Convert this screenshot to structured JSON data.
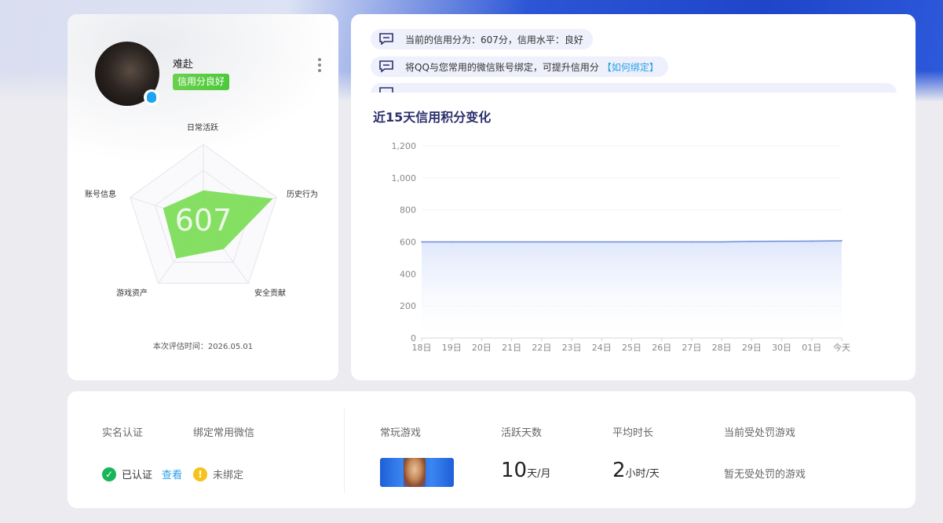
{
  "profile": {
    "name": "难赴",
    "credit_tag": "信用分良好",
    "score": "607",
    "eval_time": "本次评估时间：2026.05.01",
    "radar": {
      "dimensions": [
        "日常活跃",
        "历史行为",
        "安全贡献",
        "游戏资产",
        "账号信息"
      ],
      "values": [
        0.4,
        0.95,
        0.45,
        0.6,
        0.55
      ]
    }
  },
  "notices": [
    {
      "text": "当前的信用分为：607分，信用水平：良好",
      "link": ""
    },
    {
      "text": "将QQ与您常用的微信账号绑定，可提升信用分",
      "link": "【如何绑定】"
    }
  ],
  "chart_data": {
    "type": "area",
    "title": "近15天信用积分变化",
    "categories": [
      "18日",
      "19日",
      "20日",
      "21日",
      "22日",
      "23日",
      "24日",
      "25日",
      "26日",
      "27日",
      "28日",
      "29日",
      "30日",
      "01日",
      "今天"
    ],
    "values": [
      600,
      600,
      600,
      600,
      600,
      600,
      600,
      600,
      600,
      600,
      600,
      603,
      604,
      605,
      607
    ],
    "yticks": [
      "0",
      "200",
      "400",
      "600",
      "800",
      "1,000",
      "1,200"
    ],
    "ylim": [
      0,
      1200
    ],
    "grid": true,
    "colors": {
      "line": "#6b8ed8",
      "fill": "#dfe7fb"
    }
  },
  "bottom": {
    "realname_label": "实名认证",
    "realname_status": "已认证",
    "realname_view": "查看",
    "wechat_label": "绑定常用微信",
    "wechat_status": "未绑定",
    "games_label": "常玩游戏",
    "active_label": "活跃天数",
    "active_value": "10",
    "active_unit": "天/月",
    "avg_label": "平均时长",
    "avg_value": "2",
    "avg_unit": "小时/天",
    "penalty_label": "当前受处罚游戏",
    "penalty_value": "暂无受处罚的游戏"
  }
}
